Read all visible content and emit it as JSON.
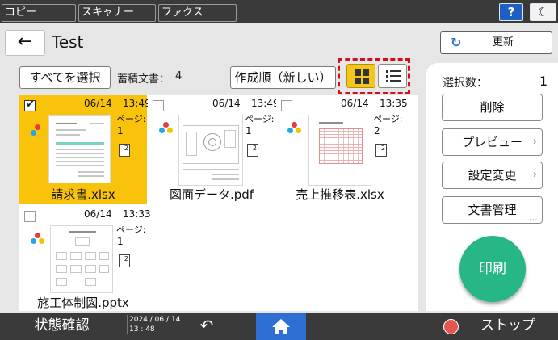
{
  "top_tabs": [
    {
      "label": "コピー"
    },
    {
      "label": "スキャナー"
    },
    {
      "label": "ファクス"
    }
  ],
  "header": {
    "help_label": "?",
    "night_label": "☾",
    "back_icon": "←",
    "title": "Test",
    "refresh_icon": "↻",
    "refresh_label": "更新"
  },
  "toolbar": {
    "select_all_label": "すべてを選択",
    "stored_label": "蓄積文書：",
    "stored_count": "4",
    "sort_label": "作成順（新しい）",
    "view_mode": "grid"
  },
  "files": [
    {
      "name": "請求書.xlsx",
      "date": "06/14",
      "time": "13:49",
      "pages_label": "ページ:",
      "pages": "1",
      "duplex_icon": "2",
      "selected": true
    },
    {
      "name": "図面データ.pdf",
      "date": "06/14",
      "time": "13:49",
      "pages_label": "ページ:",
      "pages": "1",
      "duplex_icon": "2",
      "selected": false
    },
    {
      "name": "売上推移表.xlsx",
      "date": "06/14",
      "time": "13:35",
      "pages_label": "ページ:",
      "pages": "2",
      "duplex_icon": "2",
      "selected": false
    },
    {
      "name": "施工体制図.pptx",
      "date": "06/14",
      "time": "13:33",
      "pages_label": "ページ:",
      "pages": "1",
      "duplex_icon": "2",
      "selected": false
    }
  ],
  "side_panel": {
    "selected_label": "選択数：",
    "selected_count": "1",
    "delete_label": "削除",
    "preview_label": "プレビュー",
    "settings_label": "設定変更",
    "manage_label": "文書管理",
    "chevron": "›",
    "more": "...",
    "print_label": "印刷"
  },
  "bottom_bar": {
    "status_label": "状態確認",
    "date": "2024 / 06 / 14",
    "time": "13 : 48",
    "undo_icon": "↶",
    "stop_label": "ストップ"
  },
  "colors": {
    "selected_card": "#f8c30a",
    "highlight_outline": "#d30f1c",
    "print_button": "#27b686",
    "home_button": "#2f6fd4",
    "help_button": "#1e5fc4"
  }
}
